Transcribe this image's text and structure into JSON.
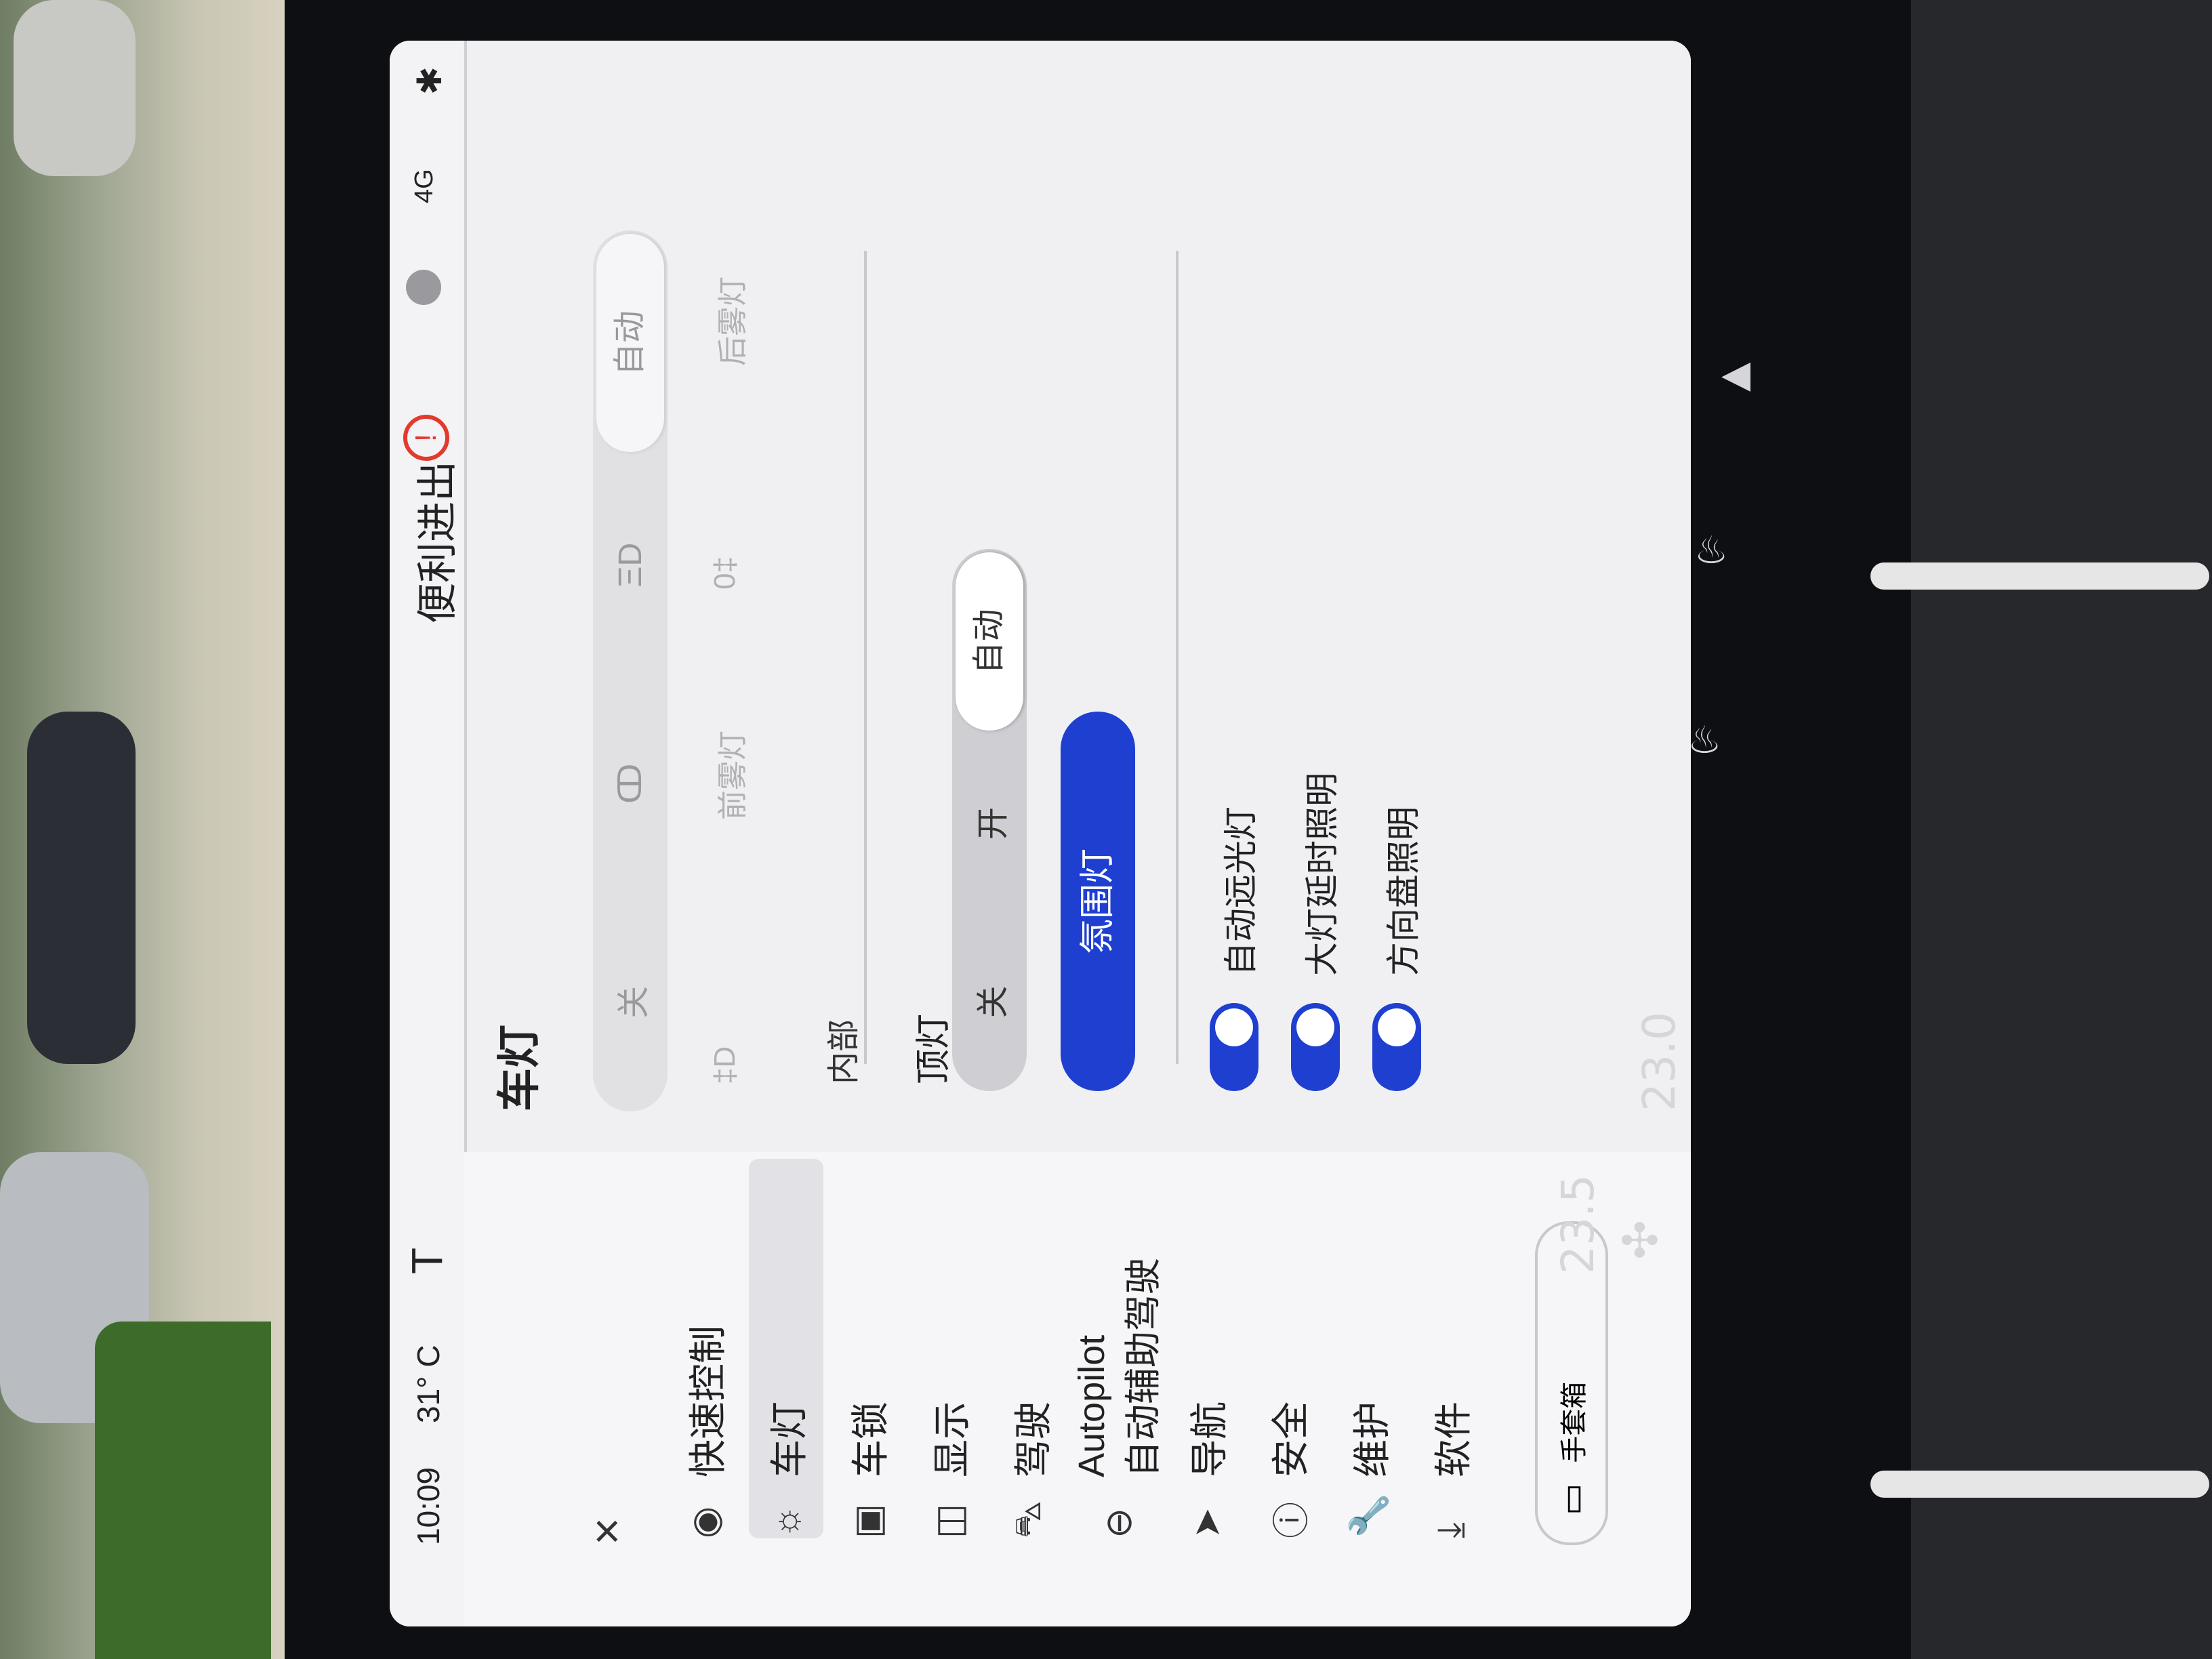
{
  "status_bar": {
    "time": "10:09",
    "temperature": "31° C",
    "homelink": "便利进出",
    "network": "4G",
    "bluetooth_icon": "bluetooth-icon",
    "alert_symbol": "!"
  },
  "nav": {
    "close_symbol": "×",
    "items": [
      {
        "label": "快速控制",
        "icon": "toggle-icon"
      },
      {
        "label": "车灯",
        "icon": "light-icon"
      },
      {
        "label": "车锁",
        "icon": "lock-icon"
      },
      {
        "label": "显示",
        "icon": "display-icon"
      },
      {
        "label": "驾驶",
        "icon": "car-icon"
      },
      {
        "label": "Autopilot",
        "sublabel": "自动辅助驾驶",
        "icon": "steering-wheel-icon"
      },
      {
        "label": "导航",
        "icon": "navigation-icon"
      },
      {
        "label": "安全",
        "icon": "safety-icon"
      },
      {
        "label": "维护",
        "icon": "wrench-icon"
      },
      {
        "label": "软件",
        "icon": "download-icon"
      }
    ],
    "glovebox": "手套箱"
  },
  "panel": {
    "title": "车灯",
    "exterior_lights": {
      "options": [
        "关",
        "自动"
      ],
      "selected": "自动",
      "front_fog": "前雾灯",
      "rear_fog": "后雾灯"
    },
    "interior": {
      "section_label": "内部",
      "dome_label": "顶灯",
      "dome_options": [
        "关",
        "开",
        "自动"
      ],
      "dome_selected": "自动",
      "ambient_button": "氛围灯"
    },
    "toggles": [
      {
        "label": "自动远光灯",
        "on": true
      },
      {
        "label": "大灯延时照明",
        "on": true
      },
      {
        "label": "方向盘照明",
        "on": true
      }
    ]
  },
  "climate": {
    "driver_temp": "23.5",
    "passenger_temp": "23.0",
    "fan_icon": "fan-icon",
    "seat_heat_icon": "seat-heater-icon",
    "volume_icon": "speaker-icon"
  },
  "colors": {
    "accent": "#1e3fd0",
    "alert": "#e23a2e"
  }
}
